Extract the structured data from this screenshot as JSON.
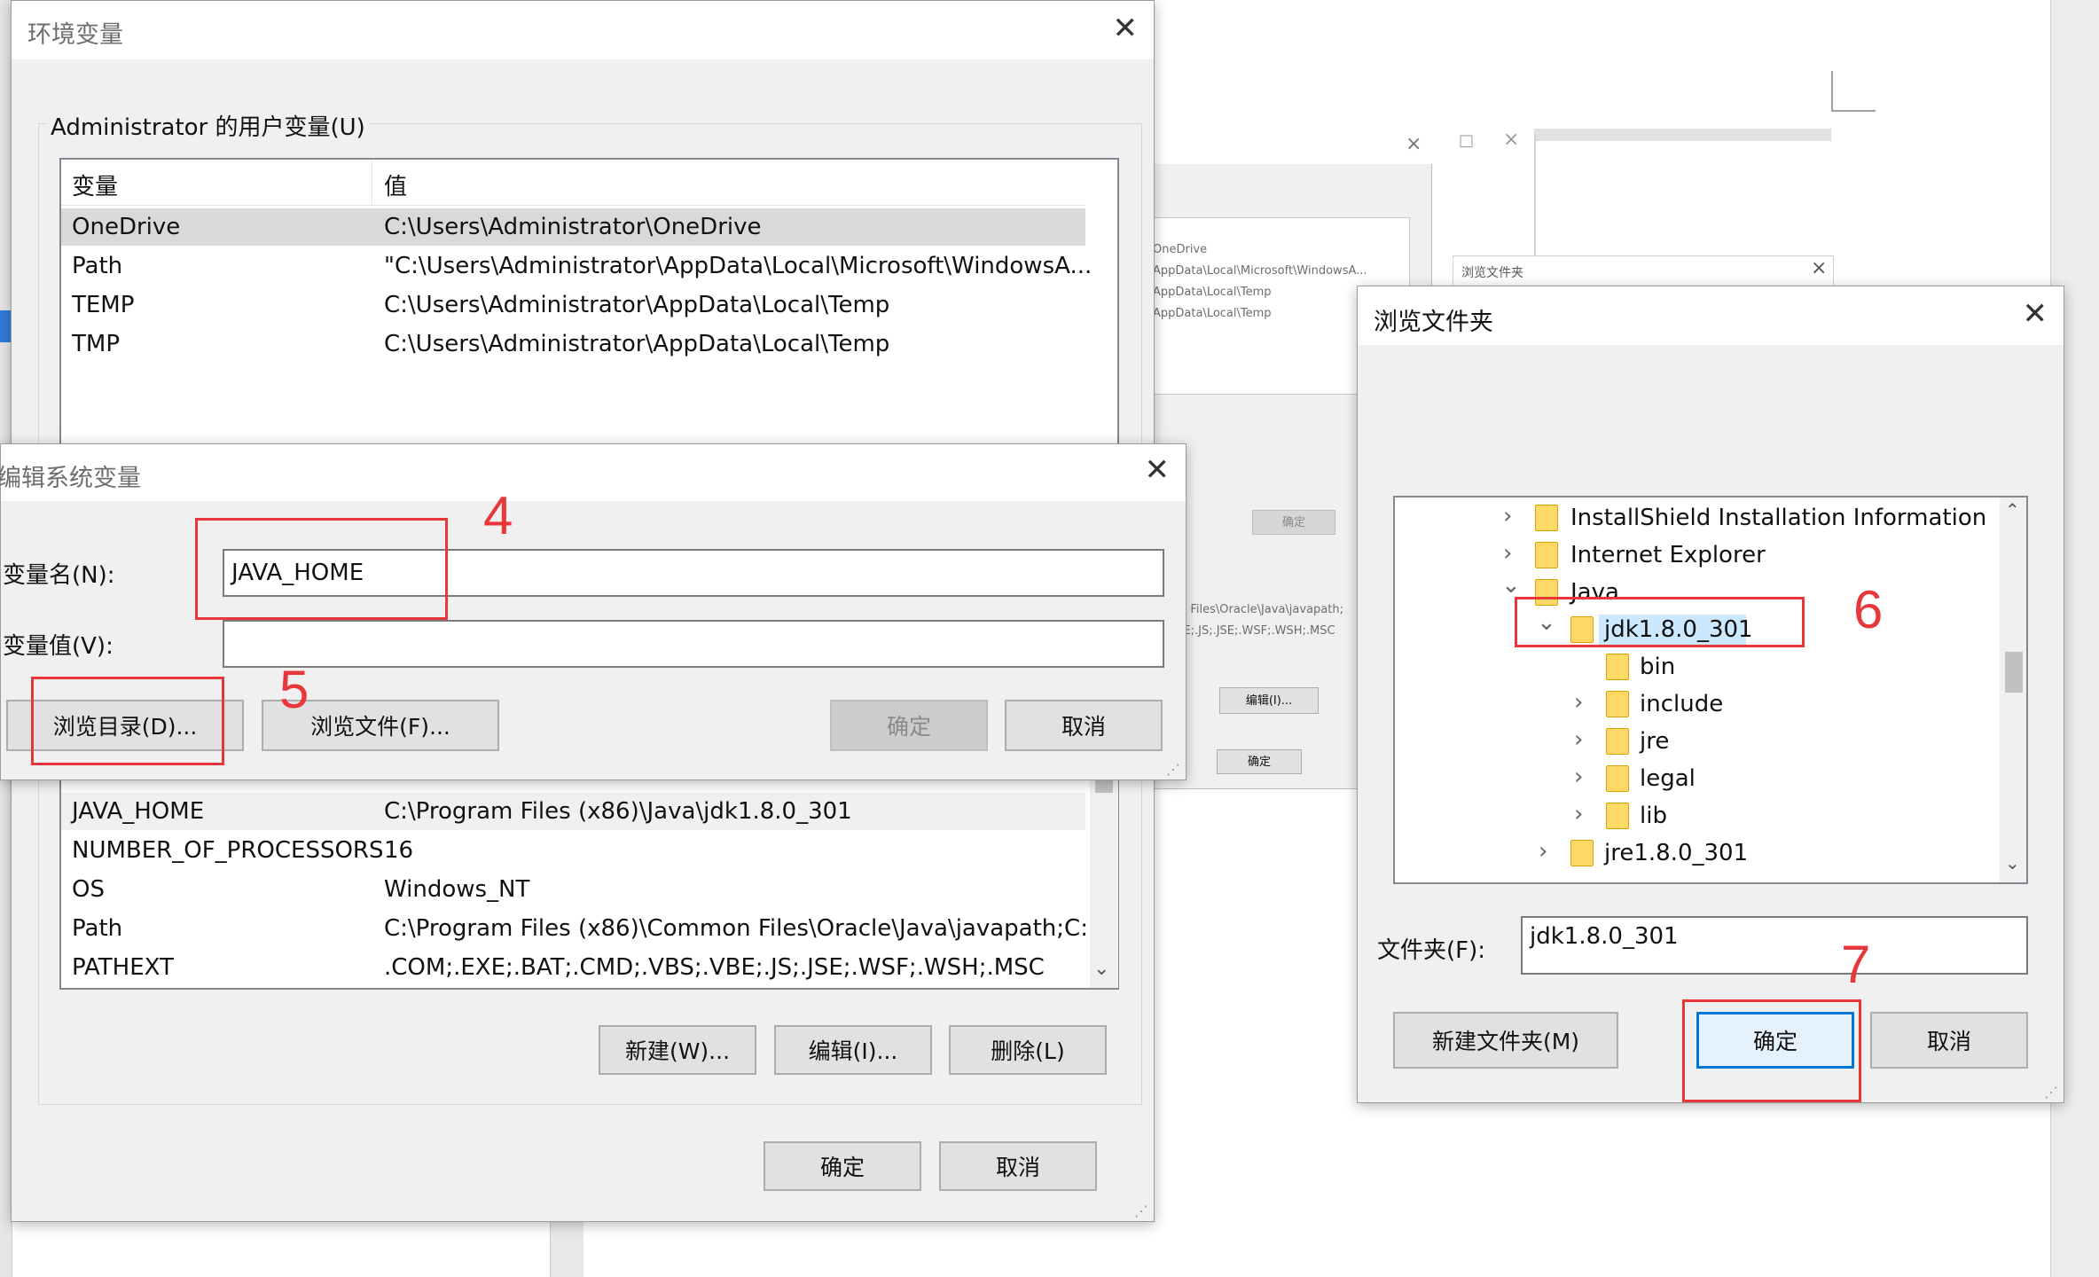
{
  "env_window": {
    "title": "环境变量",
    "user_group_label": "Administrator 的用户变量(U)",
    "columns": [
      "变量",
      "值"
    ],
    "user_vars": [
      {
        "name": "OneDrive",
        "value": "C:\\Users\\Administrator\\OneDrive"
      },
      {
        "name": "Path",
        "value": "\"C:\\Users\\Administrator\\AppData\\Local\\Microsoft\\WindowsA..."
      },
      {
        "name": "TEMP",
        "value": "C:\\Users\\Administrator\\AppData\\Local\\Temp"
      },
      {
        "name": "TMP",
        "value": "C:\\Users\\Administrator\\AppData\\Local\\Temp"
      }
    ],
    "system_vars": [
      {
        "name": "JAVA_HOME",
        "value": "C:\\Program Files (x86)\\Java\\jdk1.8.0_301"
      },
      {
        "name": "NUMBER_OF_PROCESSORS",
        "value": "16"
      },
      {
        "name": "OS",
        "value": "Windows_NT"
      },
      {
        "name": "Path",
        "value": "C:\\Program Files (x86)\\Common Files\\Oracle\\Java\\javapath;C:..."
      },
      {
        "name": "PATHEXT",
        "value": ".COM;.EXE;.BAT;.CMD;.VBS;.VBE;.JS;.JSE;.WSF;.WSH;.MSC"
      }
    ],
    "buttons": {
      "new": "新建(W)...",
      "edit": "编辑(I)...",
      "delete": "删除(L)",
      "ok": "确定",
      "cancel": "取消"
    }
  },
  "edit_window": {
    "title": "编辑系统变量",
    "name_label": "变量名(N):",
    "name_value": "JAVA_HOME",
    "value_label": "变量值(V):",
    "value_value": "",
    "buttons": {
      "browse_dir": "浏览目录(D)...",
      "browse_file": "浏览文件(F)...",
      "ok": "确定",
      "cancel": "取消"
    }
  },
  "bg_window": {
    "rows": [
      "OneDrive",
      "AppData\\Local\\Microsoft\\WindowsA...",
      "AppData\\Local\\Temp",
      "AppData\\Local\\Temp"
    ],
    "snippet1": "n Files\\Oracle\\Java\\javapath;",
    "snippet2": ";E;.JS;.JSE;.WSF;.WSH;.MSC",
    "ok": "确定",
    "edit": "编辑(I)...",
    "small_title": "浏览文件夹"
  },
  "browse_window": {
    "title": "浏览文件夹",
    "tree": [
      {
        "label": "InstallShield Installation Information",
        "chevron": "›"
      },
      {
        "label": "Internet Explorer",
        "chevron": "›"
      },
      {
        "label": "Java",
        "chevron": "⌄"
      },
      {
        "label": "jdk1.8.0_301",
        "chevron": "⌄"
      },
      {
        "label": "bin",
        "chevron": ""
      },
      {
        "label": "include",
        "chevron": "›"
      },
      {
        "label": "jre",
        "chevron": "›"
      },
      {
        "label": "legal",
        "chevron": "›"
      },
      {
        "label": "lib",
        "chevron": "›"
      },
      {
        "label": "jre1.8.0_301",
        "chevron": "›"
      }
    ],
    "folder_label": "文件夹(F):",
    "folder_value": "jdk1.8.0_301",
    "buttons": {
      "new_folder": "新建文件夹(M)",
      "ok": "确定",
      "cancel": "取消"
    }
  },
  "annotations": [
    "4",
    "5",
    "6",
    "7"
  ],
  "colors": {
    "annotation": "#e8373b",
    "selection": "#cce8ff",
    "accent": "#0078d7"
  }
}
